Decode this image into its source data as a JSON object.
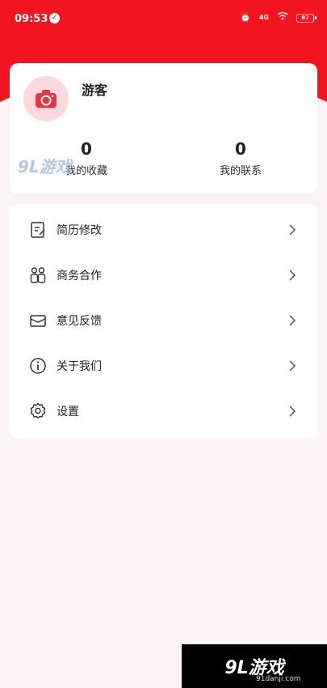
{
  "status_bar": {
    "time": "09:53",
    "network": "4G",
    "battery": "87"
  },
  "profile": {
    "username": "游客",
    "stats": [
      {
        "value": "0",
        "label": "我的收藏"
      },
      {
        "value": "0",
        "label": "我的联系"
      }
    ]
  },
  "menu": {
    "items": [
      {
        "label": "简历修改",
        "icon": "resume-edit-icon"
      },
      {
        "label": "商务合作",
        "icon": "people-icon"
      },
      {
        "label": "意见反馈",
        "icon": "mail-icon"
      },
      {
        "label": "关于我们",
        "icon": "info-icon"
      },
      {
        "label": "设置",
        "icon": "settings-icon"
      }
    ]
  },
  "watermark": {
    "brand_top": "9L游戏",
    "brand_bottom": "9L游戏",
    "site": "91danji.com"
  },
  "colors": {
    "accent": "#f2151f",
    "background": "#fbf3f5"
  }
}
